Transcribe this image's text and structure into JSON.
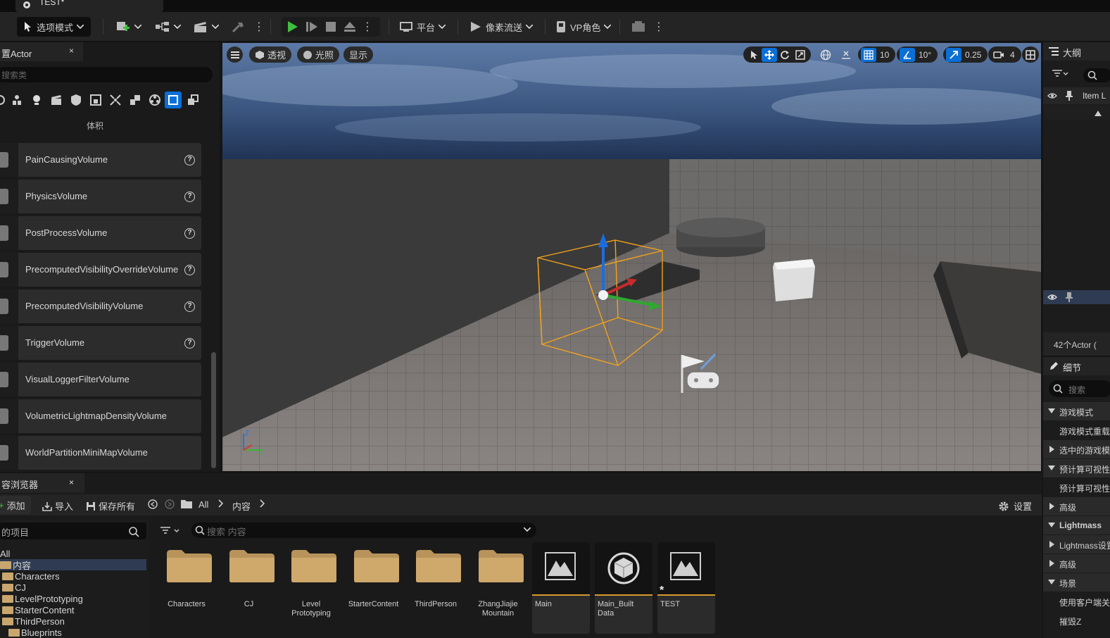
{
  "window": {
    "doc_tab": "TEST*"
  },
  "toolbar": {
    "mode_label": "选项模式",
    "platform_label": "平台",
    "pixel_streaming_label": "像素流送",
    "vp_role_label": "VP角色"
  },
  "place_actors": {
    "tab_title": "置Actor",
    "close": "×",
    "search_placeholder": "搜索类",
    "category_label": "体积",
    "items": [
      {
        "label": "PainCausingVolume"
      },
      {
        "label": "PhysicsVolume"
      },
      {
        "label": "PostProcessVolume"
      },
      {
        "label": "PrecomputedVisibilityOverrideVolume"
      },
      {
        "label": "PrecomputedVisibilityVolume"
      },
      {
        "label": "TriggerVolume"
      },
      {
        "label": "VisualLoggerFilterVolume"
      },
      {
        "label": "VolumetricLightmapDensityVolume"
      },
      {
        "label": "WorldPartitionMiniMapVolume"
      }
    ],
    "help_glyph": "?"
  },
  "viewport": {
    "perspective_label": "透视",
    "lit_label": "光照",
    "show_label": "显示",
    "grid_snap": "10",
    "rotation_snap": "10°",
    "scale_snap": "0.25",
    "camera_speed": "4",
    "axis_z": "Z",
    "axis_y": "Y"
  },
  "outliner": {
    "title": "大纲",
    "column_item": "Item L",
    "actor_count": "42个Actor ("
  },
  "details": {
    "title": "细节",
    "search_placeholder": "搜索",
    "rows": [
      {
        "label": "游戏模式",
        "kind": "section-open"
      },
      {
        "label": "游戏模式重载",
        "kind": "item"
      },
      {
        "label": "选中的游戏模式",
        "kind": "section-closed"
      },
      {
        "label": "预计算可视性",
        "kind": "section-open"
      },
      {
        "label": "预计算可视性",
        "kind": "item"
      },
      {
        "label": "高级",
        "kind": "section-closed"
      },
      {
        "label": "Lightmass",
        "kind": "section-open"
      },
      {
        "label": "Lightmass设置",
        "kind": "section-closed"
      },
      {
        "label": "高级",
        "kind": "section-closed"
      },
      {
        "label": "场景",
        "kind": "section-open"
      },
      {
        "label": "使用客户端关卡",
        "kind": "item"
      },
      {
        "label": "摧毁Z",
        "kind": "item"
      }
    ]
  },
  "content_browser": {
    "tab_title": "容浏览器",
    "close": "×",
    "add_label": "添加",
    "import_label": "导入",
    "save_all_label": "保存所有",
    "path": [
      "All",
      "内容"
    ],
    "settings_label": "设置",
    "tree_search": "的项目",
    "search_placeholder": "搜索 内容",
    "tree": [
      {
        "label": "All",
        "indent": 0,
        "folder": false,
        "selected": false
      },
      {
        "label": "内容",
        "indent": 0,
        "folder": true,
        "selected": true
      },
      {
        "label": "Characters",
        "indent": 1,
        "folder": true,
        "selected": false
      },
      {
        "label": "CJ",
        "indent": 1,
        "folder": true,
        "selected": false
      },
      {
        "label": "LevelPrototyping",
        "indent": 1,
        "folder": true,
        "selected": false
      },
      {
        "label": "StarterContent",
        "indent": 1,
        "folder": true,
        "selected": false
      },
      {
        "label": "ThirdPerson",
        "indent": 1,
        "folder": true,
        "selected": false
      },
      {
        "label": "Blueprints",
        "indent": 2,
        "folder": true,
        "selected": false
      }
    ],
    "folders": [
      {
        "label": "Characters"
      },
      {
        "label": "CJ"
      },
      {
        "label": "Level Prototyping"
      },
      {
        "label": "StarterContent"
      },
      {
        "label": "ThirdPerson"
      },
      {
        "label": "ZhangJiajie Mountain"
      }
    ],
    "assets": [
      {
        "label": "Main",
        "icon": "level-icon"
      },
      {
        "label": "Main_Built Data",
        "icon": "mapbuilddata-icon"
      },
      {
        "label": "TEST",
        "icon": "level-icon"
      }
    ]
  },
  "colors": {
    "accent_blue": "#0a6fd6",
    "play_green": "#3fbf3f",
    "selection_orange": "#f4a21a",
    "asset_underline": "#d79a2c"
  }
}
